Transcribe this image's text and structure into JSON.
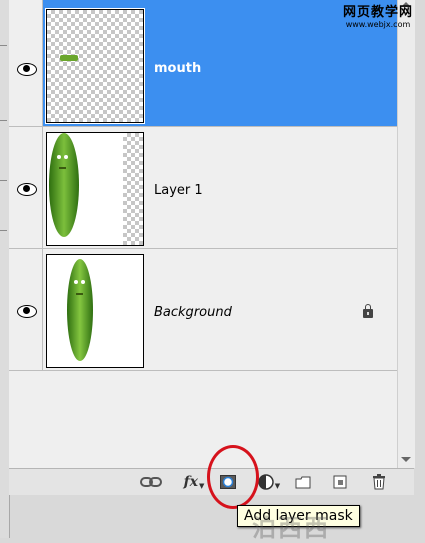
{
  "layers": [
    {
      "name": "mouth",
      "selected": true,
      "visible": true,
      "locked": false
    },
    {
      "name": "Layer 1",
      "selected": false,
      "visible": true,
      "locked": false
    },
    {
      "name": "Background",
      "selected": false,
      "visible": true,
      "locked": true
    }
  ],
  "toolbar": {
    "buttons": [
      "link-layers-icon",
      "layer-style-icon",
      "add-layer-mask-icon",
      "adjustment-layer-icon",
      "new-group-icon",
      "new-layer-icon",
      "delete-layer-icon"
    ],
    "fx_label": "fx"
  },
  "tooltip": {
    "text": "Add layer mask"
  },
  "watermark": {
    "top_line1": "网页教学网",
    "top_line2": "www.webjx.com",
    "bottom": "泊西西"
  },
  "colors": {
    "selection": "#3c8ff0",
    "highlight_ring": "#d6121c",
    "tooltip_bg": "#ffffe1"
  }
}
